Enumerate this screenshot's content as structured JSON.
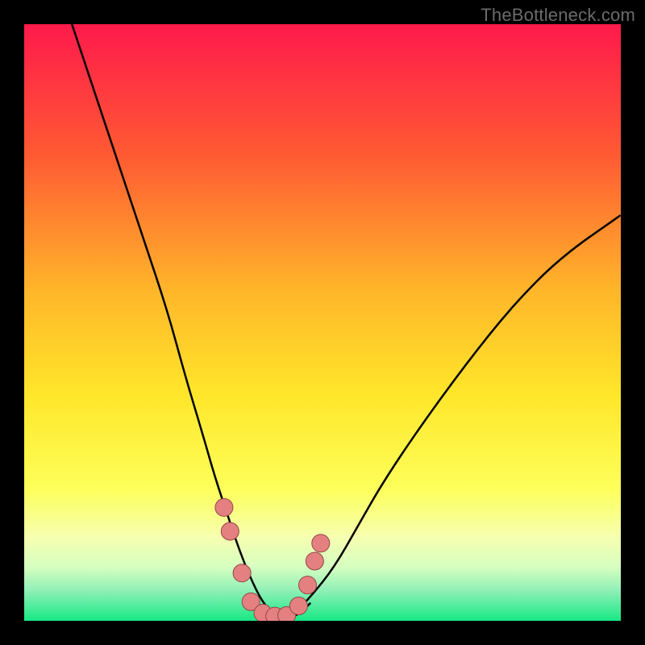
{
  "watermark": {
    "text": "TheBottleneck.com"
  },
  "colors": {
    "black": "#000000",
    "watermark": "#6b6b6b",
    "curve": "#000000",
    "marker_fill": "#e58081",
    "marker_stroke": "#914646",
    "gradient_top": "#ff1a4b",
    "gradient_mid1": "#ff8a2a",
    "gradient_mid2": "#ffe22a",
    "gradient_mid3": "#f6ff8a",
    "gradient_mid4": "#c4ffb0",
    "gradient_bottom": "#17e884"
  },
  "chart_data": {
    "type": "line",
    "title": "",
    "xlabel": "",
    "ylabel": "",
    "xlim": [
      0,
      100
    ],
    "ylim": [
      0,
      100
    ],
    "grid": false,
    "series": [
      {
        "name": "left-curve",
        "x": [
          8,
          12,
          16,
          20,
          24,
          27,
          30,
          32,
          34,
          36,
          38,
          40,
          42
        ],
        "y": [
          100,
          88,
          76,
          64,
          52,
          41,
          31,
          24,
          18,
          12,
          7,
          3,
          1
        ]
      },
      {
        "name": "right-curve",
        "x": [
          45,
          48,
          52,
          56,
          60,
          66,
          74,
          82,
          90,
          100
        ],
        "y": [
          1,
          4,
          9,
          16,
          23,
          32,
          43,
          53,
          61,
          68
        ]
      },
      {
        "name": "valley",
        "x": [
          38,
          40,
          42,
          44,
          46,
          48
        ],
        "y": [
          3,
          1,
          0.5,
          0.5,
          1,
          3
        ]
      }
    ],
    "markers": [
      {
        "x": 33.5,
        "y": 19
      },
      {
        "x": 34.5,
        "y": 15
      },
      {
        "x": 36.5,
        "y": 8
      },
      {
        "x": 38.0,
        "y": 3.2
      },
      {
        "x": 40.0,
        "y": 1.3
      },
      {
        "x": 42.0,
        "y": 0.8
      },
      {
        "x": 44.0,
        "y": 0.9
      },
      {
        "x": 46.0,
        "y": 2.5
      },
      {
        "x": 47.5,
        "y": 6
      },
      {
        "x": 48.7,
        "y": 10
      },
      {
        "x": 49.7,
        "y": 13
      }
    ],
    "gradient_stops": [
      {
        "offset": 0,
        "color": "#ff1a4b"
      },
      {
        "offset": 22,
        "color": "#ff5a33"
      },
      {
        "offset": 45,
        "color": "#ffb72a"
      },
      {
        "offset": 62,
        "color": "#ffe62a"
      },
      {
        "offset": 78,
        "color": "#fdff5a"
      },
      {
        "offset": 86,
        "color": "#f6ffb0"
      },
      {
        "offset": 91,
        "color": "#d6ffc0"
      },
      {
        "offset": 95,
        "color": "#8eefb6"
      },
      {
        "offset": 100,
        "color": "#17e884"
      }
    ]
  }
}
